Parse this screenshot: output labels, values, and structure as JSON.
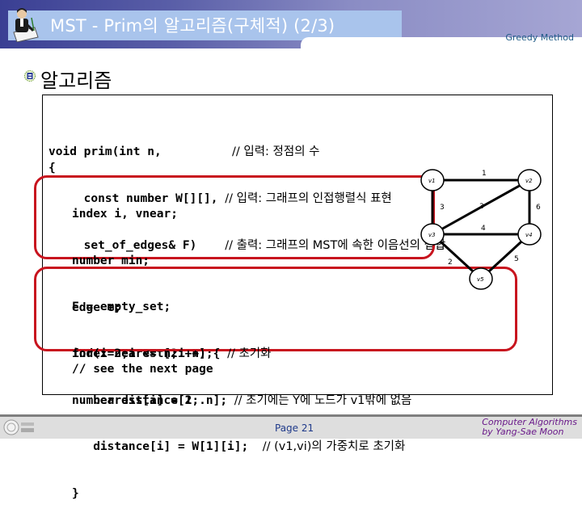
{
  "header": {
    "title": "MST - Prim의 알고리즘(구체적) (2/3)",
    "section_tag": "Greedy Method",
    "logo_icon": "person-writing-icon"
  },
  "heading": {
    "bullet_icon": "emblem-bullet-icon",
    "text": "알고리즘"
  },
  "code": {
    "signature": [
      {
        "code": "void prim(int n,          ",
        "comment": "// 입력: 정점의 수"
      },
      {
        "code": "     const number W[][], ",
        "comment": "// 입력: 그래프의 인접행렬식 표현"
      },
      {
        "code": "     set_of_edges& F)    ",
        "comment": "// 출력: 그래프의 MST에 속한 이음선의 집합"
      }
    ],
    "open_brace": "{",
    "declarations": [
      "index i, vnear;",
      "number min;",
      "edge e;",
      "index nearest[2..n];",
      "number distance[2..n];"
    ],
    "init": [
      {
        "code": "F = empty_set;",
        "comment": ""
      },
      {
        "code": "for(i=2;i <= n;i++) { ",
        "comment": "// 초기화"
      },
      {
        "code": "   nearest[i] = 1;     ",
        "comment": "// 초기에는 Y에 노드가 v1밖에 없음"
      },
      {
        "code": "   distance[i] = W[1][i];  ",
        "comment": "// (v1,vi)의 가중치로 초기화"
      },
      {
        "code": "}",
        "comment": ""
      }
    ],
    "continuation": "// see the next page"
  },
  "graph": {
    "nodes": [
      {
        "id": "v1",
        "label": "v1"
      },
      {
        "id": "v2",
        "label": "v2"
      },
      {
        "id": "v3",
        "label": "v3"
      },
      {
        "id": "v4",
        "label": "v4"
      },
      {
        "id": "v5",
        "label": "v5"
      }
    ],
    "edges": [
      {
        "from": "v1",
        "to": "v2",
        "weight": "1"
      },
      {
        "from": "v1",
        "to": "v3",
        "weight": "3"
      },
      {
        "from": "v2",
        "to": "v3",
        "weight": "3"
      },
      {
        "from": "v2",
        "to": "v4",
        "weight": "6"
      },
      {
        "from": "v3",
        "to": "v4",
        "weight": "4"
      },
      {
        "from": "v3",
        "to": "v5",
        "weight": "2"
      },
      {
        "from": "v4",
        "to": "v5",
        "weight": "5"
      }
    ]
  },
  "footer": {
    "page": "Page 21",
    "credit_line1": "Computer Algorithms",
    "credit_line2": "by Yang-Sae Moon",
    "logo_icon": "university-logo-icon"
  },
  "colors": {
    "highlight_red": "#c8141e",
    "title_bar": "#a9c4ec",
    "band_dark": "#3a3f93"
  }
}
